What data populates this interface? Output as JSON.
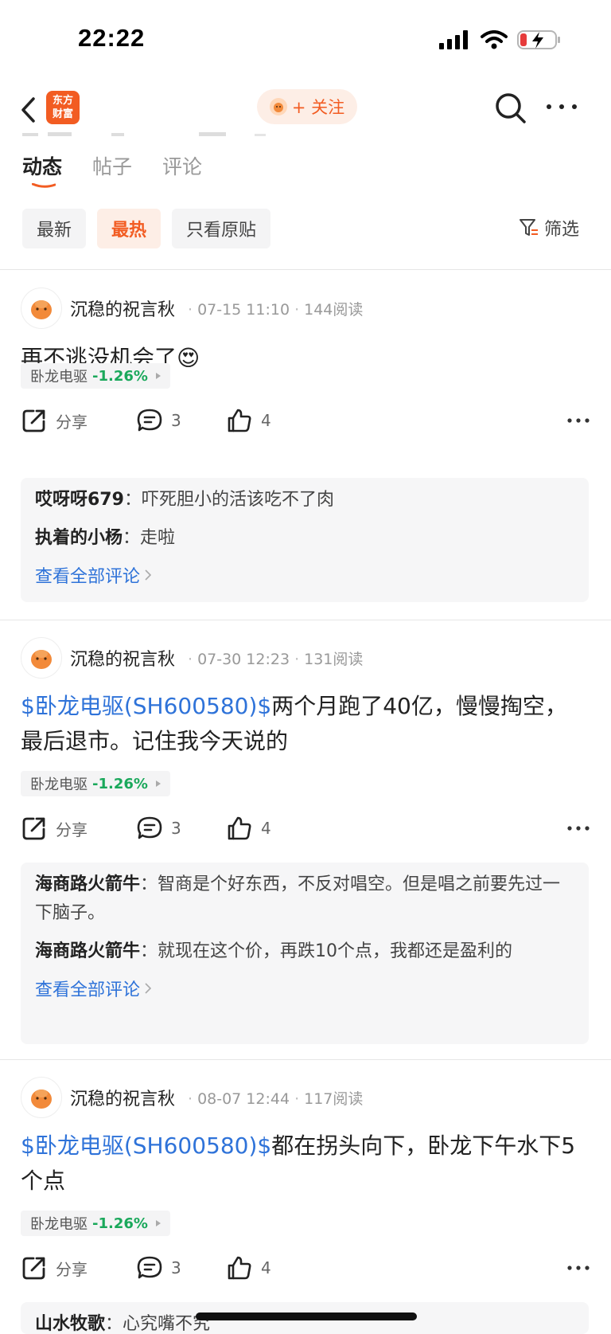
{
  "status_bar": {
    "time": "22:22"
  },
  "nav": {
    "logo_line1": "东方",
    "logo_line2": "财富",
    "follow_label": "+ 关注"
  },
  "tabs": [
    {
      "label": "动态",
      "active": true
    },
    {
      "label": "帖子",
      "active": false
    },
    {
      "label": "评论",
      "active": false
    }
  ],
  "filters": {
    "chips": [
      {
        "label": "最新",
        "active": false
      },
      {
        "label": "最热",
        "active": true
      },
      {
        "label": "只看原贴",
        "active": false
      }
    ],
    "filter_label": "筛选"
  },
  "colors": {
    "accent": "#f25c22",
    "link": "#2f73d9",
    "down": "#1aa85b"
  },
  "posts": [
    {
      "author": "沉稳的祝言秋",
      "date": "07-15 11:10",
      "reads": "144阅读",
      "stock_link": "",
      "text": "再不逃没机会了😍",
      "tag": {
        "name": "卧龙电驱",
        "change": "-1.26%"
      },
      "actions": {
        "share": "分享",
        "comments": "3",
        "likes": "4"
      },
      "comments": [
        {
          "user": "哎呀呀679",
          "sep": "：",
          "text": "吓死胆小的活该吃不了肉"
        },
        {
          "user": "执着的小杨",
          "sep": "：",
          "text": "走啦"
        }
      ],
      "view_all": "查看全部评论"
    },
    {
      "author": "沉稳的祝言秋",
      "date": "07-30 12:23",
      "reads": "131阅读",
      "stock_link": "$卧龙电驱(SH600580)$",
      "text": "两个月跑了40亿，慢慢掏空，最后退市。记住我今天说的",
      "tag": {
        "name": "卧龙电驱",
        "change": "-1.26%"
      },
      "actions": {
        "share": "分享",
        "comments": "3",
        "likes": "4"
      },
      "comments": [
        {
          "user": "海商路火箭牛",
          "sep": "：",
          "text": "智商是个好东西，不反对唱空。但是唱之前要先过一下脑子。"
        },
        {
          "user": "海商路火箭牛",
          "sep": "：",
          "text": "就现在这个价，再跌10个点，我都还是盈利的"
        }
      ],
      "view_all": "查看全部评论"
    },
    {
      "author": "沉稳的祝言秋",
      "date": "08-07 12:44",
      "reads": "117阅读",
      "stock_link": "$卧龙电驱(SH600580)$",
      "text": "都在拐头向下，卧龙下午水下5个点",
      "tag": {
        "name": "卧龙电驱",
        "change": "-1.26%"
      },
      "actions": {
        "share": "分享",
        "comments": "3",
        "likes": "4"
      },
      "comments": [
        {
          "user": "山水牧歌",
          "sep": "：",
          "text": "心究嘴不究"
        }
      ],
      "view_all": ""
    }
  ]
}
